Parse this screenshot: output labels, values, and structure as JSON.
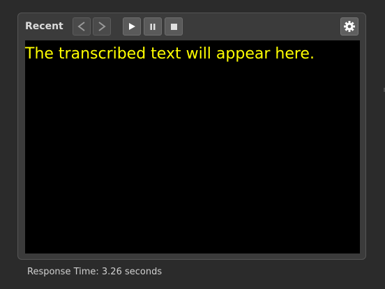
{
  "toolbar": {
    "recent_label": "Recent",
    "prev_icon": "chevron-left-icon",
    "next_icon": "chevron-right-icon",
    "play_icon": "play-icon",
    "pause_icon": "pause-icon",
    "stop_icon": "stop-icon",
    "settings_icon": "gear-icon"
  },
  "display": {
    "transcript_text": "The transcribed text will appear here.",
    "text_color": "#ffff00",
    "background_color": "#000000"
  },
  "status": {
    "response_time": "Response Time: 3.26 seconds"
  }
}
